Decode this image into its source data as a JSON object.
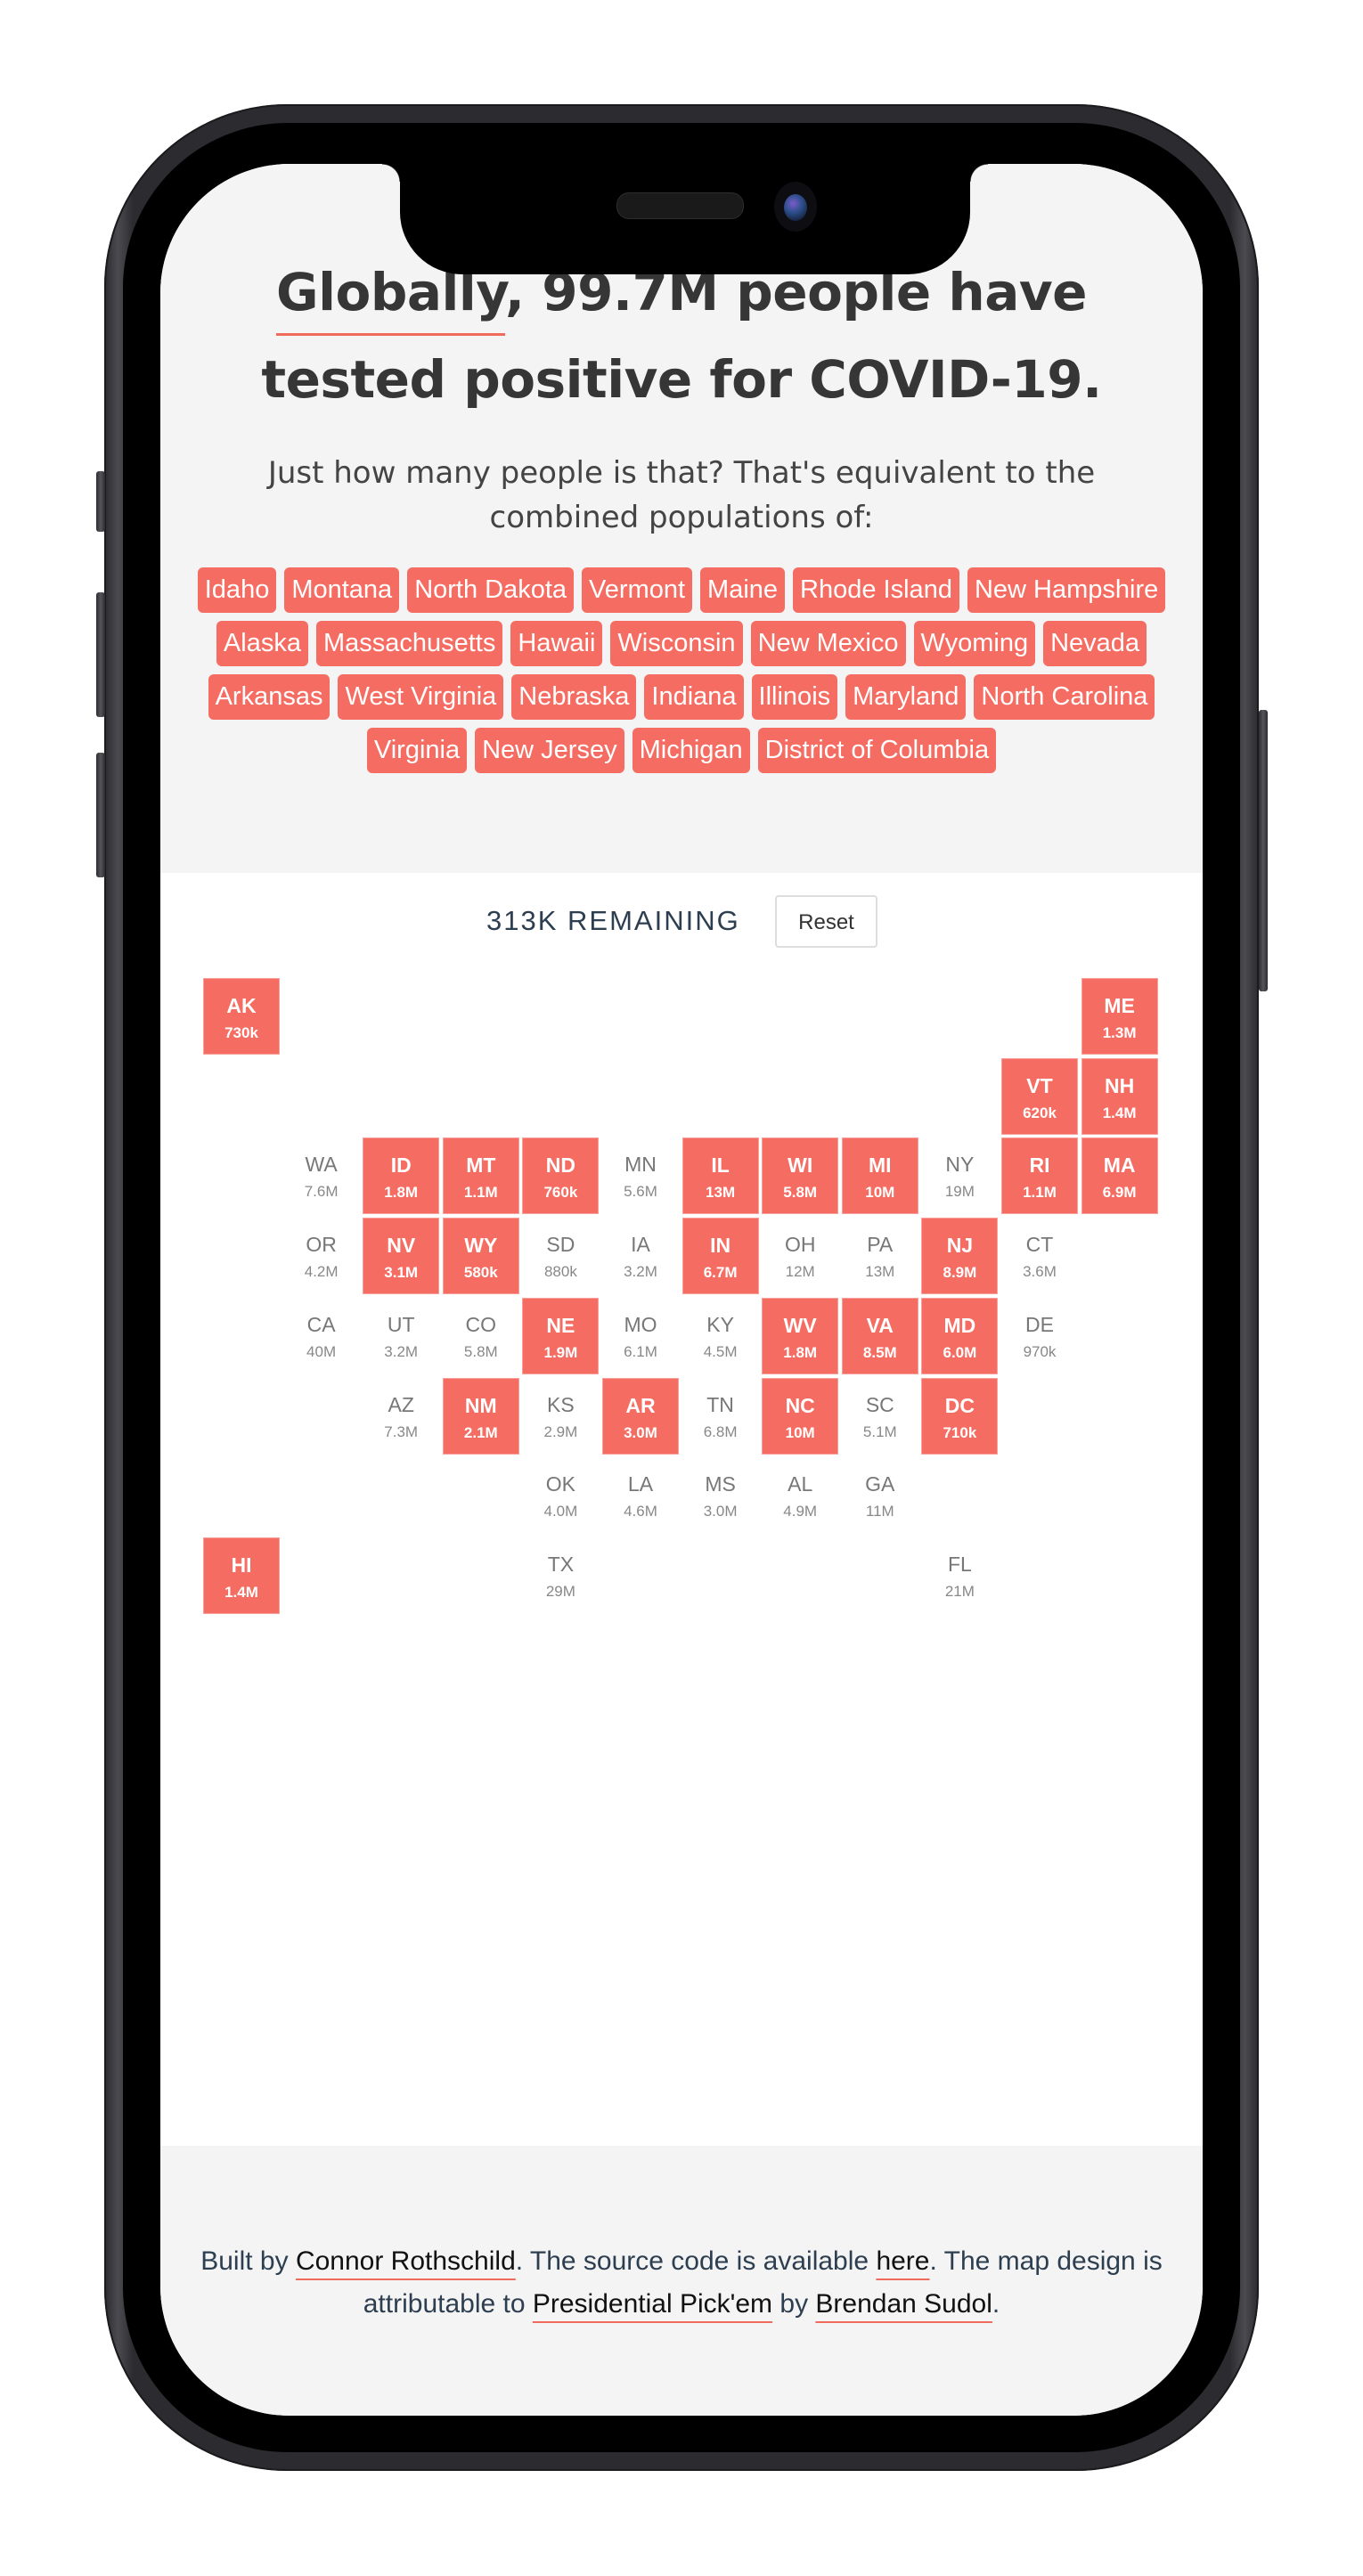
{
  "header": {
    "headline_highlight": "Globally",
    "headline_rest": ", 99.7M people have tested positive for COVID-19.",
    "subtitle": "Just how many people is that? That's equivalent to the combined populations of:"
  },
  "tags": [
    "Idaho",
    "Montana",
    "North Dakota",
    "Vermont",
    "Maine",
    "Rhode Island",
    "New Hampshire",
    "Alaska",
    "Massachusetts",
    "Hawaii",
    "Wisconsin",
    "New Mexico",
    "Wyoming",
    "Nevada",
    "Arkansas",
    "West Virginia",
    "Nebraska",
    "Indiana",
    "Illinois",
    "Maryland",
    "North Carolina",
    "Virginia",
    "New Jersey",
    "Michigan",
    "District of Columbia"
  ],
  "controls": {
    "remaining": "313K REMAINING",
    "reset_label": "Reset"
  },
  "colors": {
    "accent": "#f56d62",
    "text_dark": "#363636",
    "text_navy": "#2c3e50",
    "background_gray": "#f4f4f4"
  },
  "map": {
    "states": [
      {
        "abbr": "AK",
        "value": "730k",
        "selected": true,
        "row": 0,
        "col": 0
      },
      {
        "abbr": "ME",
        "value": "1.3M",
        "selected": true,
        "row": 0,
        "col": 11
      },
      {
        "abbr": "VT",
        "value": "620k",
        "selected": true,
        "row": 1,
        "col": 10
      },
      {
        "abbr": "NH",
        "value": "1.4M",
        "selected": true,
        "row": 1,
        "col": 11
      },
      {
        "abbr": "WA",
        "value": "7.6M",
        "selected": false,
        "row": 2,
        "col": 1
      },
      {
        "abbr": "ID",
        "value": "1.8M",
        "selected": true,
        "row": 2,
        "col": 2
      },
      {
        "abbr": "MT",
        "value": "1.1M",
        "selected": true,
        "row": 2,
        "col": 3
      },
      {
        "abbr": "ND",
        "value": "760k",
        "selected": true,
        "row": 2,
        "col": 4
      },
      {
        "abbr": "MN",
        "value": "5.6M",
        "selected": false,
        "row": 2,
        "col": 5
      },
      {
        "abbr": "IL",
        "value": "13M",
        "selected": true,
        "row": 2,
        "col": 6
      },
      {
        "abbr": "WI",
        "value": "5.8M",
        "selected": true,
        "row": 2,
        "col": 7
      },
      {
        "abbr": "MI",
        "value": "10M",
        "selected": true,
        "row": 2,
        "col": 8
      },
      {
        "abbr": "NY",
        "value": "19M",
        "selected": false,
        "row": 2,
        "col": 9
      },
      {
        "abbr": "RI",
        "value": "1.1M",
        "selected": true,
        "row": 2,
        "col": 10
      },
      {
        "abbr": "MA",
        "value": "6.9M",
        "selected": true,
        "row": 2,
        "col": 11
      },
      {
        "abbr": "OR",
        "value": "4.2M",
        "selected": false,
        "row": 3,
        "col": 1
      },
      {
        "abbr": "NV",
        "value": "3.1M",
        "selected": true,
        "row": 3,
        "col": 2
      },
      {
        "abbr": "WY",
        "value": "580k",
        "selected": true,
        "row": 3,
        "col": 3
      },
      {
        "abbr": "SD",
        "value": "880k",
        "selected": false,
        "row": 3,
        "col": 4
      },
      {
        "abbr": "IA",
        "value": "3.2M",
        "selected": false,
        "row": 3,
        "col": 5
      },
      {
        "abbr": "IN",
        "value": "6.7M",
        "selected": true,
        "row": 3,
        "col": 6
      },
      {
        "abbr": "OH",
        "value": "12M",
        "selected": false,
        "row": 3,
        "col": 7
      },
      {
        "abbr": "PA",
        "value": "13M",
        "selected": false,
        "row": 3,
        "col": 8
      },
      {
        "abbr": "NJ",
        "value": "8.9M",
        "selected": true,
        "row": 3,
        "col": 9
      },
      {
        "abbr": "CT",
        "value": "3.6M",
        "selected": false,
        "row": 3,
        "col": 10
      },
      {
        "abbr": "CA",
        "value": "40M",
        "selected": false,
        "row": 4,
        "col": 1
      },
      {
        "abbr": "UT",
        "value": "3.2M",
        "selected": false,
        "row": 4,
        "col": 2
      },
      {
        "abbr": "CO",
        "value": "5.8M",
        "selected": false,
        "row": 4,
        "col": 3
      },
      {
        "abbr": "NE",
        "value": "1.9M",
        "selected": true,
        "row": 4,
        "col": 4
      },
      {
        "abbr": "MO",
        "value": "6.1M",
        "selected": false,
        "row": 4,
        "col": 5
      },
      {
        "abbr": "KY",
        "value": "4.5M",
        "selected": false,
        "row": 4,
        "col": 6
      },
      {
        "abbr": "WV",
        "value": "1.8M",
        "selected": true,
        "row": 4,
        "col": 7
      },
      {
        "abbr": "VA",
        "value": "8.5M",
        "selected": true,
        "row": 4,
        "col": 8
      },
      {
        "abbr": "MD",
        "value": "6.0M",
        "selected": true,
        "row": 4,
        "col": 9
      },
      {
        "abbr": "DE",
        "value": "970k",
        "selected": false,
        "row": 4,
        "col": 10
      },
      {
        "abbr": "AZ",
        "value": "7.3M",
        "selected": false,
        "row": 5,
        "col": 2
      },
      {
        "abbr": "NM",
        "value": "2.1M",
        "selected": true,
        "row": 5,
        "col": 3
      },
      {
        "abbr": "KS",
        "value": "2.9M",
        "selected": false,
        "row": 5,
        "col": 4
      },
      {
        "abbr": "AR",
        "value": "3.0M",
        "selected": true,
        "row": 5,
        "col": 5
      },
      {
        "abbr": "TN",
        "value": "6.8M",
        "selected": false,
        "row": 5,
        "col": 6
      },
      {
        "abbr": "NC",
        "value": "10M",
        "selected": true,
        "row": 5,
        "col": 7
      },
      {
        "abbr": "SC",
        "value": "5.1M",
        "selected": false,
        "row": 5,
        "col": 8
      },
      {
        "abbr": "DC",
        "value": "710k",
        "selected": true,
        "row": 5,
        "col": 9
      },
      {
        "abbr": "OK",
        "value": "4.0M",
        "selected": false,
        "row": 6,
        "col": 4
      },
      {
        "abbr": "LA",
        "value": "4.6M",
        "selected": false,
        "row": 6,
        "col": 5
      },
      {
        "abbr": "MS",
        "value": "3.0M",
        "selected": false,
        "row": 6,
        "col": 6
      },
      {
        "abbr": "AL",
        "value": "4.9M",
        "selected": false,
        "row": 6,
        "col": 7
      },
      {
        "abbr": "GA",
        "value": "11M",
        "selected": false,
        "row": 6,
        "col": 8
      },
      {
        "abbr": "HI",
        "value": "1.4M",
        "selected": true,
        "row": 7,
        "col": 0
      },
      {
        "abbr": "TX",
        "value": "29M",
        "selected": false,
        "row": 7,
        "col": 4
      },
      {
        "abbr": "FL",
        "value": "21M",
        "selected": false,
        "row": 7,
        "col": 9
      }
    ]
  },
  "footer": {
    "t1": "Built by ",
    "link_author": "Connor Rothschild",
    "t2": ". The source code is available ",
    "link_source": "here",
    "t3": ". The map design is attributable to ",
    "link_design": "Presidential Pick'em",
    "t4": " by ",
    "link_designer": "Brendan Sudol",
    "t5": "."
  }
}
